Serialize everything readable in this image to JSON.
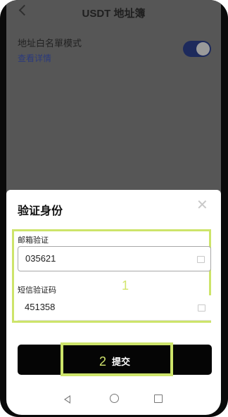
{
  "header": {
    "title": "USDT 地址簿",
    "whitelist_label": "地址白名單模式",
    "details_link": "查看详情",
    "whitelist_enabled": true
  },
  "dialog": {
    "title": "验证身份",
    "email_label": "邮箱验证",
    "email_code": "035621",
    "sms_label": "短信验证码",
    "sms_code": "451358",
    "submit_label": "提交"
  },
  "annotations": {
    "marker_1": "1",
    "marker_2": "2",
    "highlight_color": "#cde46a"
  },
  "nav_icons": [
    "back-icon",
    "home-icon",
    "recent-apps-icon"
  ]
}
